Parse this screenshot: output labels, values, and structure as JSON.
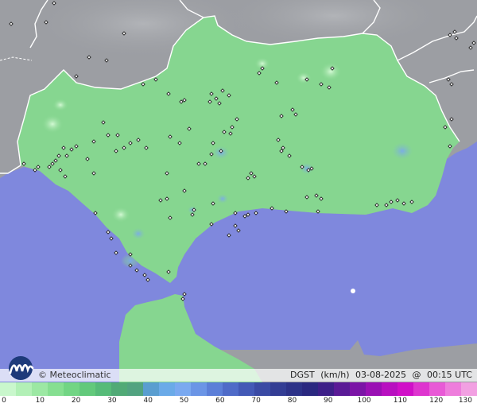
{
  "map": {
    "colors": {
      "sea": "#7f88dd",
      "neighbor_land": "#9c9ea3",
      "region_land": "#86d690",
      "border": "#ffffff",
      "station": "#222222"
    }
  },
  "footer": {
    "copyright": "© Meteoclimatic",
    "variable": "DGST",
    "unit": "(km/h)",
    "date": "03-08-2025",
    "at": "@",
    "time": "00:15 UTC"
  },
  "legend": {
    "ticks": [
      "0",
      "10",
      "20",
      "30",
      "40",
      "50",
      "60",
      "70",
      "80",
      "90",
      "100",
      "110",
      "120",
      "130"
    ],
    "colors": [
      "#c9f7cc",
      "#b2f0b6",
      "#9ce8a3",
      "#86df91",
      "#72d584",
      "#62c97b",
      "#56bb78",
      "#51aa76",
      "#52a380",
      "#5a9ed0",
      "#6aaae8",
      "#7aa9f0",
      "#6b95e6",
      "#5c7fd8",
      "#4f6bc8",
      "#4359b6",
      "#3a4aa4",
      "#333d94",
      "#2d3288",
      "#2a2880",
      "#3d1f88",
      "#5a1a96",
      "#7b14a6",
      "#9a10b4",
      "#b810c0",
      "#d010c8",
      "#de35cf",
      "#e85ad6",
      "#ee7ddc",
      "#f2a0e2"
    ]
  }
}
